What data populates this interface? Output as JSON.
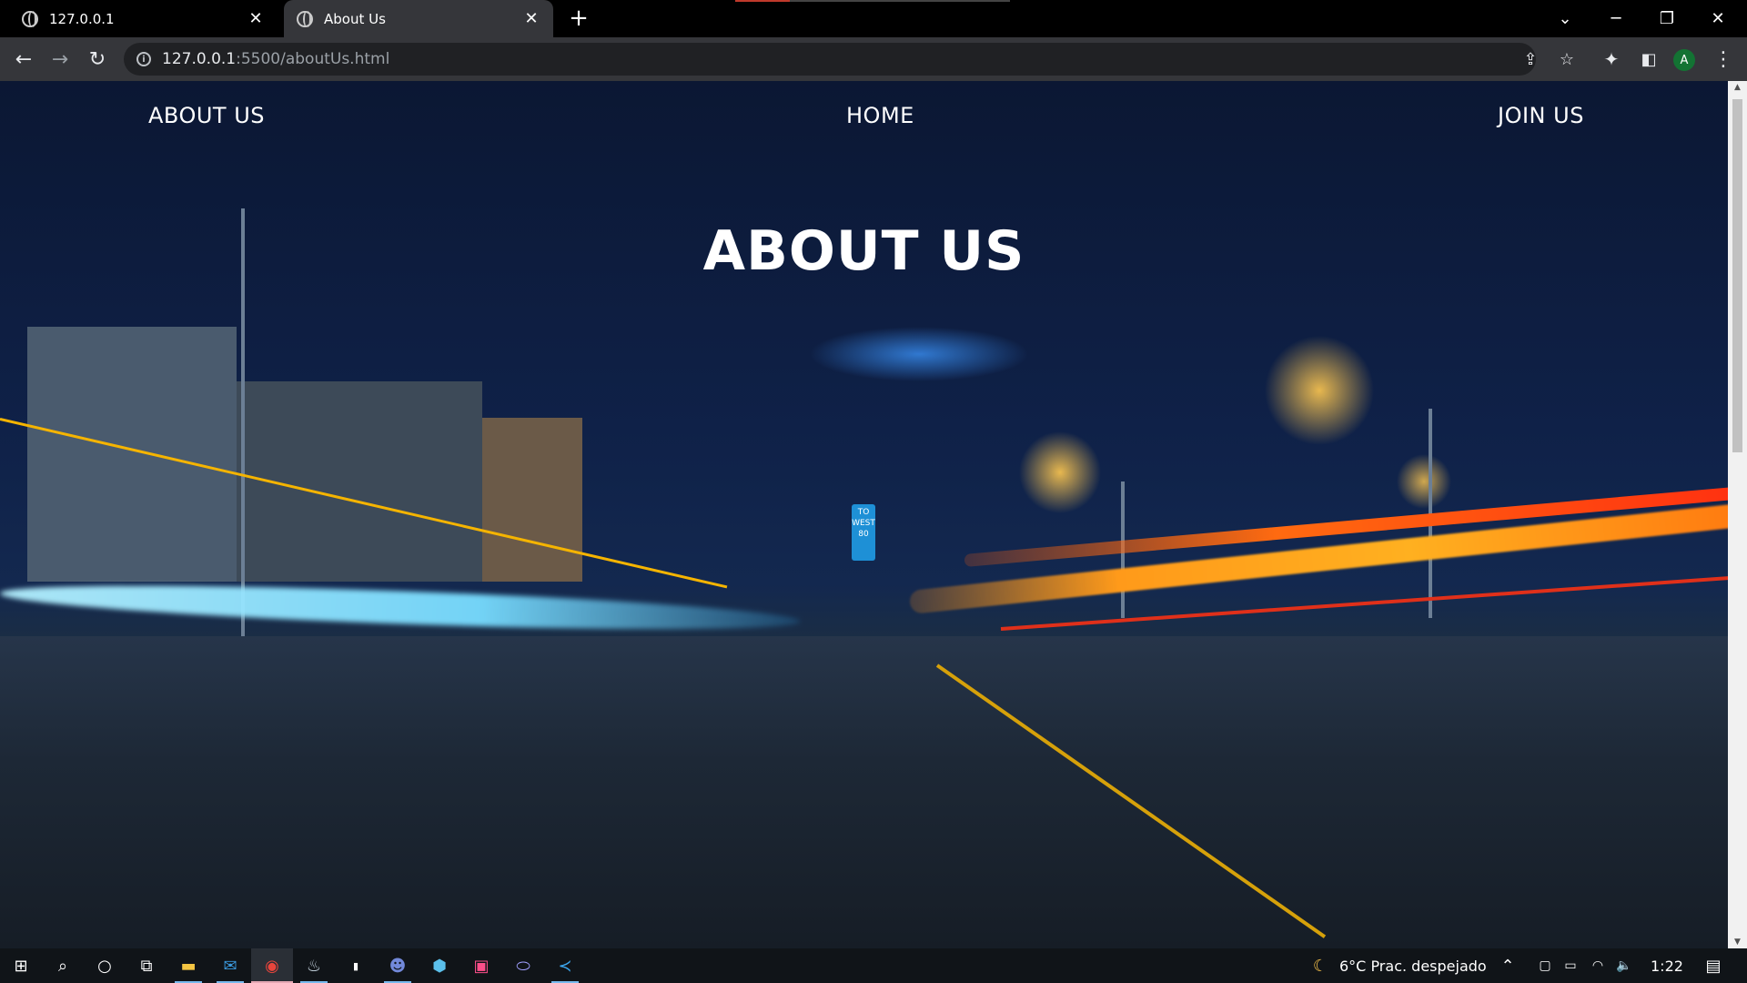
{
  "browser": {
    "tabs": [
      {
        "title": "127.0.0.1",
        "active": false
      },
      {
        "title": "About Us",
        "active": true
      }
    ],
    "new_tab": "+",
    "url_host": "127.0.0.1",
    "url_path": ":5500/aboutUs.html",
    "profile_initial": "A"
  },
  "page": {
    "nav": {
      "about": "ABOUT US",
      "home": "HOME",
      "join": "JOIN US"
    },
    "title": "ABOUT US",
    "sign_lines": [
      "TO",
      "WEST",
      "80"
    ]
  },
  "taskbar": {
    "weather": "6°C  Prac. despejado",
    "time": "1:22"
  },
  "colors": {
    "tab_bar": "#000000",
    "toolbar": "#35363a",
    "sky": "#0f2148",
    "avatar": "#137333"
  }
}
